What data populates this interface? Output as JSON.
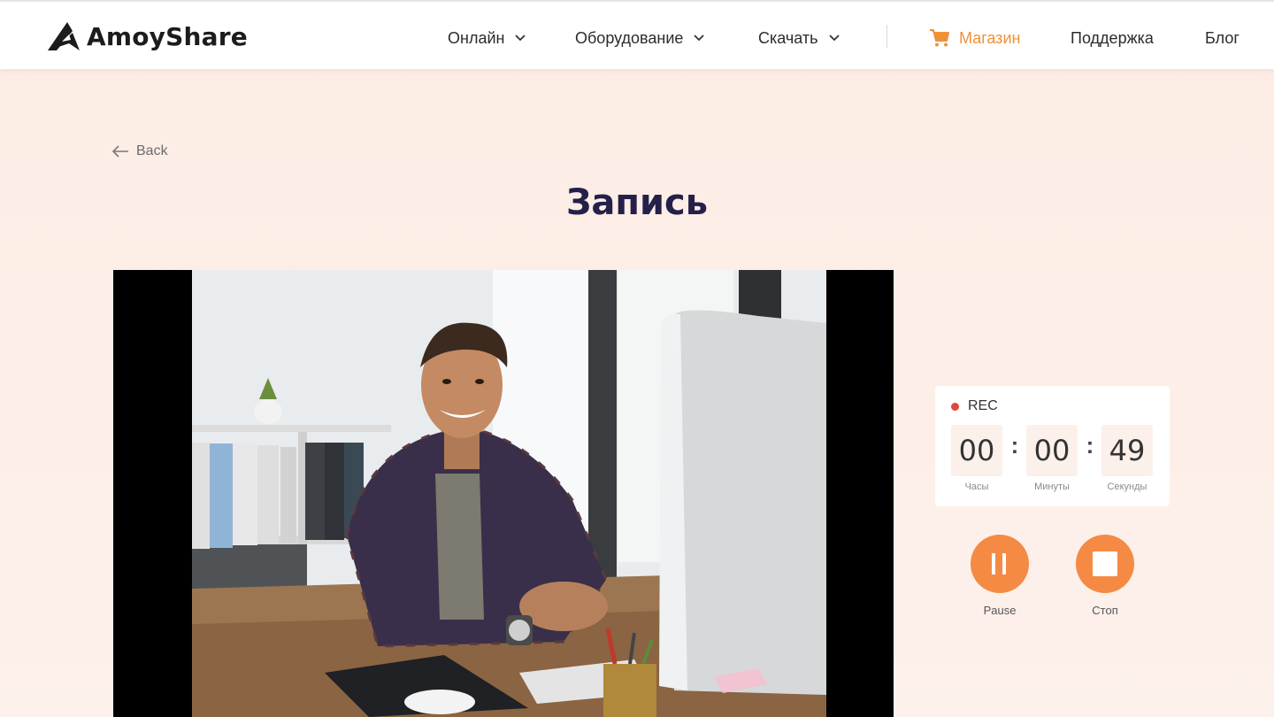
{
  "header": {
    "logo_text": "AmoyShare",
    "nav": [
      {
        "label": "Онлайн",
        "has_dropdown": true
      },
      {
        "label": "Оборудование",
        "has_dropdown": true
      },
      {
        "label": "Скачать",
        "has_dropdown": true
      }
    ],
    "store_label": "Магазин",
    "support_label": "Поддержка",
    "blog_label": "Блог",
    "accent_color": "#f0913a"
  },
  "back_label": "Back",
  "page_title": "Запись",
  "recorder": {
    "rec_label": "REC",
    "hours": "00",
    "minutes": "00",
    "seconds": "49",
    "hours_label": "Часы",
    "minutes_label": "Минуты",
    "seconds_label": "Секунды",
    "pause_label": "Pause",
    "stop_label": "Стоп",
    "button_color": "#f58a45"
  }
}
